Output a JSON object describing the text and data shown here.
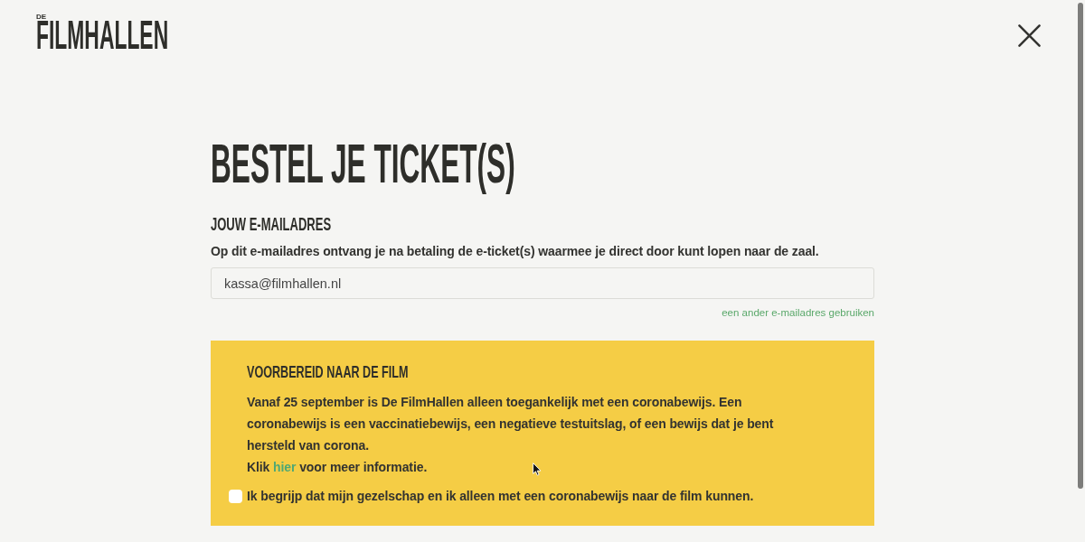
{
  "header": {
    "logo": {
      "prefix": "DE",
      "name": "FILMHALLEN"
    }
  },
  "title": "BESTEL JE TICKET(S)",
  "email_section": {
    "heading": "JOUW E-MAILADRES",
    "description": "Op dit e-mailadres ontvang je na betaling de e-ticket(s) waarmee je direct door kunt lopen naar de zaal.",
    "email_value": "kassa@filmhallen.nl",
    "alternative_link": "een ander e-mailadres gebruiken"
  },
  "notice": {
    "heading": "VOORBEREID NAAR DE FILM",
    "body": "Vanaf 25 september is De FilmHallen alleen toegankelijk met een coronabewijs. Een coronabewijs is een vaccinatiebewijs, een negatieve testuitslag, of een bewijs dat je bent hersteld van corona.",
    "more_info": {
      "before": "Klik",
      "link": "hier",
      "after": "voor meer informatie."
    },
    "agreement": {
      "label": "Ik begrijp dat mijn gezelschap en ik alleen met een coronabewijs naar de film kunnen.",
      "checked": false
    }
  }
}
